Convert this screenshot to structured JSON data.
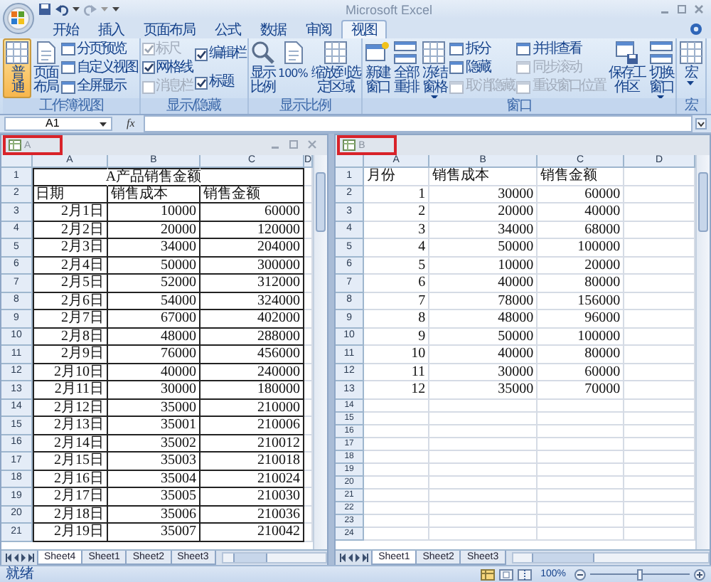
{
  "title_bar": {
    "title": "Microsoft Excel"
  },
  "tabs": [
    {
      "label": "开始",
      "selected": false
    },
    {
      "label": "插入",
      "selected": false
    },
    {
      "label": "页面布局",
      "selected": false
    },
    {
      "label": "公式",
      "selected": false
    },
    {
      "label": "数据",
      "selected": false
    },
    {
      "label": "审阅",
      "selected": false
    },
    {
      "label": "视图",
      "selected": true
    }
  ],
  "ribbon": [
    {
      "label": "工作簿视图",
      "columns": [
        {
          "kind": "large",
          "label": "普通",
          "selected": true
        },
        {
          "kind": "large",
          "label": "页面布局",
          "selected": false
        },
        {
          "kind": "stack",
          "items": [
            {
              "kind": "small",
              "label": "分页预览",
              "disabled": false
            },
            {
              "kind": "small",
              "label": "自定义视图",
              "disabled": false
            },
            {
              "kind": "small",
              "label": "全屏显示",
              "disabled": false
            }
          ]
        }
      ]
    },
    {
      "label": "显示/隐藏",
      "columns": [
        {
          "kind": "stack",
          "items": [
            {
              "kind": "check",
              "label": "标尺",
              "checked": true,
              "disabled": true
            },
            {
              "kind": "check",
              "label": "网格线",
              "checked": true,
              "disabled": false
            },
            {
              "kind": "check",
              "label": "消息栏",
              "checked": false,
              "disabled": true
            }
          ]
        },
        {
          "kind": "stack",
          "items": [
            {
              "kind": "check",
              "label": "编辑栏",
              "checked": true,
              "disabled": false
            },
            {
              "kind": "check",
              "label": "标题",
              "checked": true,
              "disabled": false
            }
          ]
        }
      ]
    },
    {
      "label": "显示比例",
      "columns": [
        {
          "kind": "large",
          "label": "显示比例"
        },
        {
          "kind": "large",
          "label": "100%"
        },
        {
          "kind": "large",
          "label": "缩放到选定区域"
        }
      ]
    },
    {
      "label": "窗口",
      "columns": [
        {
          "kind": "large",
          "label": "新建窗口"
        },
        {
          "kind": "large",
          "label": "全部重排"
        },
        {
          "kind": "large",
          "label": "冻结窗格",
          "dropdown": true
        },
        {
          "kind": "stack",
          "items": [
            {
              "kind": "small",
              "label": "拆分",
              "disabled": false
            },
            {
              "kind": "small",
              "label": "隐藏",
              "disabled": false
            },
            {
              "kind": "small",
              "label": "取消隐藏",
              "disabled": true
            }
          ]
        },
        {
          "kind": "stack",
          "items": [
            {
              "kind": "small",
              "label": "并排查看",
              "disabled": false
            },
            {
              "kind": "small",
              "label": "同步滚动",
              "disabled": true
            },
            {
              "kind": "small",
              "label": "重设窗口位置",
              "disabled": true
            }
          ]
        },
        {
          "kind": "large",
          "label": "保存工作区"
        },
        {
          "kind": "large",
          "label": "切换窗口",
          "dropdown": true
        }
      ]
    },
    {
      "label": "宏",
      "columns": [
        {
          "kind": "large",
          "label": "宏",
          "dropdown": true
        }
      ]
    }
  ],
  "formula_bar": {
    "name_box": "A1",
    "function_symbol": "fx"
  },
  "windows": [
    {
      "title": "A",
      "highlighted": true,
      "window_buttons": true,
      "bordered": true,
      "columns": [
        "A",
        "B",
        "C",
        "D"
      ],
      "rows": [
        {
          "number": "1",
          "kind": "title",
          "cells": [
            "",
            "A产品销售金额",
            ""
          ]
        },
        {
          "number": "2",
          "kind": "header",
          "cells": [
            "日期",
            "销售成本",
            "销售金额"
          ]
        },
        {
          "number": "3",
          "kind": "data",
          "cells": [
            "2月1日",
            "10000",
            "60000"
          ]
        },
        {
          "number": "4",
          "kind": "data",
          "cells": [
            "2月2日",
            "20000",
            "120000"
          ]
        },
        {
          "number": "5",
          "kind": "data",
          "cells": [
            "2月3日",
            "34000",
            "204000"
          ]
        },
        {
          "number": "6",
          "kind": "data",
          "cells": [
            "2月4日",
            "50000",
            "300000"
          ]
        },
        {
          "number": "7",
          "kind": "data",
          "cells": [
            "2月5日",
            "52000",
            "312000"
          ]
        },
        {
          "number": "8",
          "kind": "data",
          "cells": [
            "2月6日",
            "54000",
            "324000"
          ]
        },
        {
          "number": "9",
          "kind": "data",
          "cells": [
            "2月7日",
            "67000",
            "402000"
          ]
        },
        {
          "number": "10",
          "kind": "data",
          "cells": [
            "2月8日",
            "48000",
            "288000"
          ]
        },
        {
          "number": "11",
          "kind": "data",
          "cells": [
            "2月9日",
            "76000",
            "456000"
          ]
        },
        {
          "number": "12",
          "kind": "data",
          "cells": [
            "2月10日",
            "40000",
            "240000"
          ]
        },
        {
          "number": "13",
          "kind": "data",
          "cells": [
            "2月11日",
            "30000",
            "180000"
          ]
        },
        {
          "number": "14",
          "kind": "data",
          "cells": [
            "2月12日",
            "35000",
            "210000"
          ]
        },
        {
          "number": "15",
          "kind": "data",
          "cells": [
            "2月13日",
            "35001",
            "210006"
          ]
        },
        {
          "number": "16",
          "kind": "data",
          "cells": [
            "2月14日",
            "35002",
            "210012"
          ]
        },
        {
          "number": "17",
          "kind": "data",
          "cells": [
            "2月15日",
            "35003",
            "210018"
          ]
        },
        {
          "number": "18",
          "kind": "data",
          "cells": [
            "2月16日",
            "35004",
            "210024"
          ]
        },
        {
          "number": "19",
          "kind": "data",
          "cells": [
            "2月17日",
            "35005",
            "210030"
          ]
        },
        {
          "number": "20",
          "kind": "data",
          "cells": [
            "2月18日",
            "35006",
            "210036"
          ]
        },
        {
          "number": "21",
          "kind": "data",
          "cells": [
            "2月19日",
            "35007",
            "210042"
          ]
        }
      ],
      "sheet_tabs": [
        {
          "label": "Sheet4",
          "selected": true
        },
        {
          "label": "Sheet1",
          "selected": false
        },
        {
          "label": "Sheet2",
          "selected": false
        },
        {
          "label": "Sheet3",
          "selected": false
        }
      ]
    },
    {
      "title": "B",
      "highlighted": true,
      "window_buttons": false,
      "bordered": false,
      "columns": [
        "A",
        "B",
        "C",
        "D"
      ],
      "rows": [
        {
          "number": "1",
          "kind": "header",
          "cells": [
            "月份",
            "销售成本",
            "销售金额"
          ]
        },
        {
          "number": "2",
          "kind": "data",
          "cells": [
            "1",
            "30000",
            "60000"
          ]
        },
        {
          "number": "3",
          "kind": "data",
          "cells": [
            "2",
            "20000",
            "40000"
          ]
        },
        {
          "number": "4",
          "kind": "data",
          "cells": [
            "3",
            "34000",
            "68000"
          ]
        },
        {
          "number": "5",
          "kind": "data",
          "cells": [
            "4",
            "50000",
            "100000"
          ]
        },
        {
          "number": "6",
          "kind": "data",
          "cells": [
            "5",
            "10000",
            "20000"
          ]
        },
        {
          "number": "7",
          "kind": "data",
          "cells": [
            "6",
            "40000",
            "80000"
          ]
        },
        {
          "number": "8",
          "kind": "data",
          "cells": [
            "7",
            "78000",
            "156000"
          ]
        },
        {
          "number": "9",
          "kind": "data",
          "cells": [
            "8",
            "48000",
            "96000"
          ]
        },
        {
          "number": "10",
          "kind": "data",
          "cells": [
            "9",
            "50000",
            "100000"
          ]
        },
        {
          "number": "11",
          "kind": "data",
          "cells": [
            "10",
            "40000",
            "80000"
          ]
        },
        {
          "number": "12",
          "kind": "data",
          "cells": [
            "11",
            "30000",
            "60000"
          ]
        },
        {
          "number": "13",
          "kind": "data",
          "cells": [
            "12",
            "35000",
            "70000"
          ]
        },
        {
          "number": "14",
          "kind": "empty"
        },
        {
          "number": "15",
          "kind": "empty"
        },
        {
          "number": "16",
          "kind": "empty"
        },
        {
          "number": "17",
          "kind": "empty"
        },
        {
          "number": "18",
          "kind": "empty"
        },
        {
          "number": "19",
          "kind": "empty"
        },
        {
          "number": "20",
          "kind": "empty"
        },
        {
          "number": "21",
          "kind": "empty"
        },
        {
          "number": "22",
          "kind": "empty"
        },
        {
          "number": "23",
          "kind": "empty"
        },
        {
          "number": "24",
          "kind": "empty"
        }
      ],
      "sheet_tabs": [
        {
          "label": "Sheet1",
          "selected": true
        },
        {
          "label": "Sheet2",
          "selected": false
        },
        {
          "label": "Sheet3",
          "selected": false
        }
      ]
    }
  ],
  "status_bar": {
    "text": "就绪",
    "zoom": "100%",
    "zoom_slider": {
      "level": 0.5
    }
  }
}
